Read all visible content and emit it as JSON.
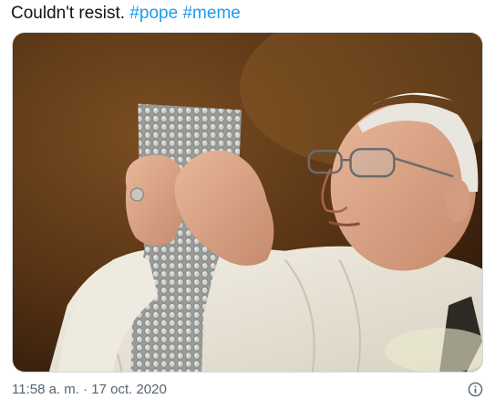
{
  "tweet": {
    "text_prefix": "Couldn't resist. ",
    "hashtags": [
      "#pope",
      "#meme"
    ],
    "timestamp": "11:58 a. m. · 17 oct. 2020"
  },
  "icons": {
    "info": "info-circle-icon"
  },
  "colors": {
    "text": "#0f1419",
    "hashtag": "#1d9bf0",
    "secondary": "#536471"
  }
}
